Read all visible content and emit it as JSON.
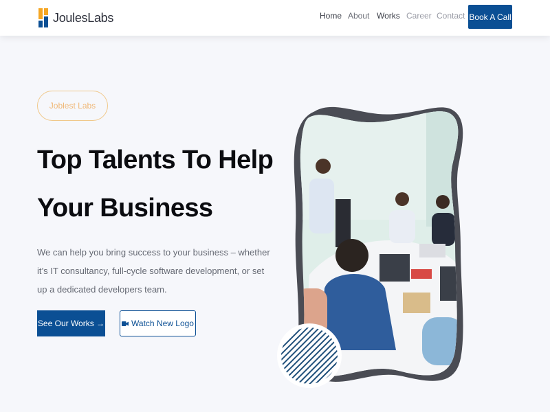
{
  "header": {
    "logo_text": "JoulesLabs",
    "nav": [
      {
        "label": "Home"
      },
      {
        "label": "About"
      },
      {
        "label": "Works"
      },
      {
        "label": "Career"
      },
      {
        "label": "Contact"
      }
    ],
    "cta_label": "Book A Call"
  },
  "hero": {
    "pill_label": "Joblest Labs",
    "headline_line1": "Top Talents To Help",
    "headline_line2": "Your Business",
    "lead": "We can help you bring success to your business – whether it’s IT consultancy, full-cycle software development, or set up a dedicated developers team.",
    "primary_button": "See Our Works →",
    "secondary_button": "Watch New Logo",
    "secondary_icon": "video-camera-icon"
  },
  "colors": {
    "brand_blue": "#0b4f94",
    "accent_orange": "#f0b877",
    "background": "#f6f7fb"
  }
}
